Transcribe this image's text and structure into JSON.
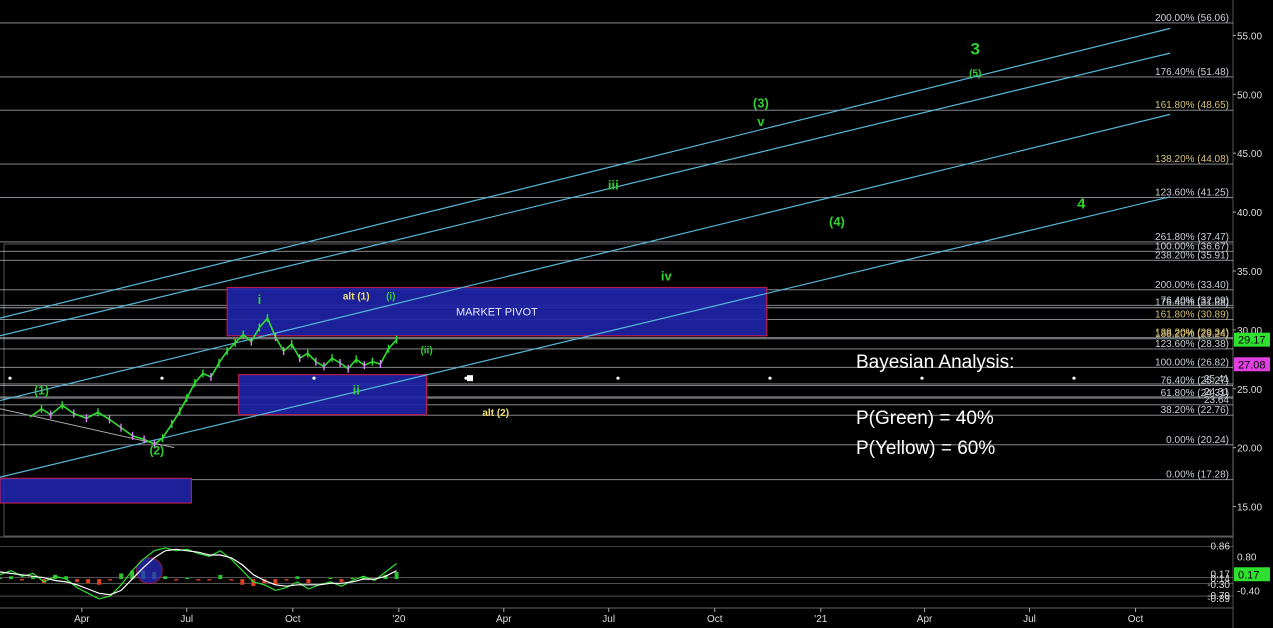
{
  "colors": {
    "background": "#000000",
    "grid": "#3a3a3a",
    "fib_line": "#c8d0d8",
    "fib_text": "#c8d0d8",
    "fib_text_gold": "#d8c27a",
    "channel": "#58b8d8",
    "pivot_box": "#1f24a8",
    "pivot_border": "#c0205a",
    "price_up": "#30e030",
    "price_down": "#e080ff",
    "green_label": "#30d030",
    "yellow_label": "#f0e070",
    "osc_line1": "#30e030",
    "osc_line2": "#ffffff",
    "osc_hist_pos": "#30c030",
    "osc_hist_neg": "#e04020",
    "bayes_text": "#ffffff",
    "price_tag_green": "#30e030",
    "price_tag_magenta": "#e040e0"
  },
  "annotation": {
    "title": "Bayesian Analysis:",
    "p_green": "P(Green) = 40%",
    "p_yellow": "P(Yellow) = 60%"
  },
  "box_labels": {
    "market_pivot": "MARKET PIVOT"
  },
  "chart_data": [
    {
      "type": "line",
      "panel": "price",
      "x_axis_labels": [
        "Apr",
        "Jul",
        "Oct",
        "'20",
        "Apr",
        "Jul",
        "Oct",
        "'21",
        "Apr",
        "Jul",
        "Oct"
      ],
      "y_ticks": [
        15.0,
        20.0,
        25.0,
        30.0,
        35.0,
        40.0,
        45.0,
        50.0,
        55.0
      ],
      "y_tick_labels": [
        "15.00",
        "20.00",
        "25.00",
        "30.00",
        "35.00",
        "40.00",
        "45.00",
        "50.00",
        "55.00"
      ],
      "ylim": [
        12.5,
        57.5
      ],
      "price_tags": [
        {
          "value": 29.17,
          "label": "29.17",
          "color": "green"
        },
        {
          "value": 27.08,
          "label": "27.08",
          "color": "magenta"
        }
      ],
      "fib_levels": [
        {
          "label": "200.00% (56.06)",
          "value": 56.06
        },
        {
          "label": "176.40% (51.48)",
          "value": 51.48
        },
        {
          "label": "161.80% (48.65)",
          "value": 48.65
        },
        {
          "label": "138.20% (44.08)",
          "value": 44.08
        },
        {
          "label": "123.60% (41.25)",
          "value": 41.25
        },
        {
          "label": "261.80% (37.47)",
          "value": 37.47
        },
        {
          "label": "100.00% (36.67)",
          "value": 36.67
        },
        {
          "label": "238.20% (35.91)",
          "value": 35.91
        },
        {
          "label": "200.00% (33.40)",
          "value": 33.4
        },
        {
          "label": "76.40% (32.09)",
          "value": 32.09
        },
        {
          "label": "176.40% (31.88)",
          "value": 31.88
        },
        {
          "label": "161.80% (30.89)",
          "value": 30.89
        },
        {
          "label": "138.20% (29.34)",
          "value": 29.34
        },
        {
          "label": "188.20% (29.24)",
          "value": 29.24
        },
        {
          "label": "123.60% (28.38)",
          "value": 28.38
        },
        {
          "label": "100.00% (26.82)",
          "value": 26.82
        },
        {
          "label": "25.41",
          "value": 25.41
        },
        {
          "label": "76.40% (25.27)",
          "value": 25.27
        },
        {
          "label": "24.31",
          "value": 24.31
        },
        {
          "label": "61.80% (24.31)",
          "value": 24.21
        },
        {
          "label": "23.64",
          "value": 23.64
        },
        {
          "label": "38.20% (22.76)",
          "value": 22.76
        },
        {
          "label": "0.00% (20.24)",
          "value": 20.24
        },
        {
          "label": "0.00% (17.28)",
          "value": 17.28
        }
      ],
      "price_series": [
        [
          "2019-02-15",
          22.6
        ],
        [
          "2019-02-25",
          23.3
        ],
        [
          "2019-03-05",
          22.8
        ],
        [
          "2019-03-15",
          23.6
        ],
        [
          "2019-03-25",
          22.9
        ],
        [
          "2019-04-05",
          22.5
        ],
        [
          "2019-04-15",
          23.0
        ],
        [
          "2019-04-25",
          22.4
        ],
        [
          "2019-05-05",
          21.7
        ],
        [
          "2019-05-15",
          21.0
        ],
        [
          "2019-05-25",
          20.7
        ],
        [
          "2019-06-03",
          20.3
        ],
        [
          "2019-06-10",
          20.8
        ],
        [
          "2019-06-18",
          22.0
        ],
        [
          "2019-06-25",
          23.1
        ],
        [
          "2019-07-01",
          24.2
        ],
        [
          "2019-07-08",
          25.5
        ],
        [
          "2019-07-15",
          26.3
        ],
        [
          "2019-07-22",
          26.0
        ],
        [
          "2019-07-29",
          27.2
        ],
        [
          "2019-08-05",
          28.2
        ],
        [
          "2019-08-12",
          28.9
        ],
        [
          "2019-08-19",
          29.6
        ],
        [
          "2019-08-26",
          29.0
        ],
        [
          "2019-09-02",
          30.2
        ],
        [
          "2019-09-09",
          31.0
        ],
        [
          "2019-09-16",
          29.4
        ],
        [
          "2019-09-23",
          28.2
        ],
        [
          "2019-09-30",
          28.8
        ],
        [
          "2019-10-07",
          27.6
        ],
        [
          "2019-10-14",
          28.0
        ],
        [
          "2019-10-21",
          27.3
        ],
        [
          "2019-10-28",
          26.9
        ],
        [
          "2019-11-04",
          27.6
        ],
        [
          "2019-11-11",
          27.2
        ],
        [
          "2019-11-18",
          26.7
        ],
        [
          "2019-11-25",
          27.5
        ],
        [
          "2019-12-02",
          27.0
        ],
        [
          "2019-12-09",
          27.3
        ],
        [
          "2019-12-16",
          27.1
        ],
        [
          "2019-12-23",
          28.4
        ],
        [
          "2019-12-30",
          29.17
        ]
      ],
      "channel_lines": [
        [
          [
            "2019-01-20",
            31.0
          ],
          [
            "2021-10-31",
            55.6
          ]
        ],
        [
          [
            "2019-01-20",
            29.5
          ],
          [
            "2021-10-31",
            53.5
          ]
        ],
        [
          [
            "2019-01-20",
            24.0
          ],
          [
            "2021-10-31",
            48.3
          ]
        ],
        [
          [
            "2019-01-20",
            17.5
          ],
          [
            "2021-10-31",
            41.3
          ]
        ]
      ],
      "boxes": [
        {
          "from": "2019-08-05",
          "to": "2020-11-15",
          "low": 29.5,
          "high": 33.6,
          "label": "MARKET PIVOT"
        },
        {
          "from": "2019-08-15",
          "to": "2020-01-25",
          "low": 22.8,
          "high": 26.2,
          "label": ""
        },
        {
          "from": "2019-01-20",
          "to": "2019-07-05",
          "low": 15.3,
          "high": 17.4,
          "label": ""
        }
      ],
      "wave_labels": [
        {
          "text": "(1)",
          "x": "2019-02-25",
          "y": 24.5,
          "color": "green",
          "size": "s"
        },
        {
          "text": "(2)",
          "x": "2019-06-05",
          "y": 19.4,
          "color": "green",
          "size": "s"
        },
        {
          "text": "i",
          "x": "2019-09-02",
          "y": 32.2,
          "color": "green",
          "size": "m"
        },
        {
          "text": "ii",
          "x": "2019-11-25",
          "y": 24.5,
          "color": "green",
          "size": "m"
        },
        {
          "text": "alt (1)",
          "x": "2019-11-25",
          "y": 32.6,
          "color": "yellow",
          "size": "xs"
        },
        {
          "text": "(i)",
          "x": "2019-12-25",
          "y": 32.6,
          "color": "green",
          "size": "xs"
        },
        {
          "text": "(ii)",
          "x": "2020-01-25",
          "y": 28.0,
          "color": "green",
          "size": "xs"
        },
        {
          "text": "alt (2)",
          "x": "2020-03-25",
          "y": 22.7,
          "color": "yellow",
          "size": "xs"
        },
        {
          "text": "iii",
          "x": "2020-07-05",
          "y": 41.9,
          "color": "green",
          "size": "m"
        },
        {
          "text": "iv",
          "x": "2020-08-20",
          "y": 34.2,
          "color": "green",
          "size": "m"
        },
        {
          "text": "(3)",
          "x": "2020-11-10",
          "y": 48.9,
          "color": "green",
          "size": "m"
        },
        {
          "text": "v",
          "x": "2020-11-10",
          "y": 47.3,
          "color": "green",
          "size": "m"
        },
        {
          "text": "(4)",
          "x": "2021-01-15",
          "y": 38.8,
          "color": "green",
          "size": "m"
        },
        {
          "text": "3",
          "x": "2021-05-15",
          "y": 53.4,
          "color": "green",
          "size": "xl"
        },
        {
          "text": "(5)",
          "x": "2021-05-15",
          "y": 51.5,
          "color": "green",
          "size": "xs"
        },
        {
          "text": "4",
          "x": "2021-08-15",
          "y": 40.3,
          "color": "green",
          "size": "l"
        }
      ]
    },
    {
      "type": "line",
      "panel": "oscillator",
      "ylim": [
        -0.95,
        1.45
      ],
      "y_tick_labels": [
        "0.80",
        "-0.40"
      ],
      "y_ticks": [
        0.8,
        -0.4
      ],
      "right_labels": [
        {
          "text": "0.86",
          "value": 1.15
        },
        {
          "text": "0.14",
          "value": 0.0
        },
        {
          "text": "0.17",
          "value": 0.17
        },
        {
          "text": "-0.30",
          "value": -0.2
        },
        {
          "text": "-0.79",
          "value": -0.6
        },
        {
          "text": "-0.89",
          "value": -0.7
        }
      ],
      "ref_levels": [
        1.15,
        0.05,
        -0.15,
        -0.6
      ],
      "series": [
        {
          "values": [
            0.15,
            0.3,
            0.1,
            0.2,
            -0.1,
            0.1,
            0.0,
            -0.3,
            -0.5,
            -0.7,
            -0.6,
            -0.2,
            0.3,
            0.7,
            1.0,
            1.1,
            1.0,
            1.05,
            0.9,
            0.8,
            1.0,
            0.7,
            0.3,
            -0.1,
            -0.2,
            -0.4,
            -0.3,
            -0.1,
            -0.35,
            -0.2,
            -0.1,
            -0.25,
            -0.05,
            0.1,
            -0.05,
            0.25,
            0.55
          ]
        },
        {
          "values": [
            0.25,
            0.2,
            0.15,
            0.1,
            0.05,
            -0.05,
            -0.1,
            -0.2,
            -0.35,
            -0.5,
            -0.55,
            -0.4,
            0.0,
            0.4,
            0.75,
            1.0,
            1.05,
            1.0,
            0.95,
            0.85,
            0.85,
            0.75,
            0.5,
            0.15,
            -0.05,
            -0.2,
            -0.25,
            -0.2,
            -0.2,
            -0.2,
            -0.15,
            -0.15,
            -0.1,
            0.0,
            0.0,
            0.1,
            0.3
          ]
        }
      ],
      "histogram": [
        0.05,
        0.1,
        -0.05,
        0.1,
        -0.15,
        0.15,
        0.1,
        -0.1,
        -0.15,
        -0.2,
        -0.05,
        0.2,
        0.3,
        0.3,
        0.25,
        0.1,
        -0.05,
        0.05,
        -0.05,
        -0.05,
        0.15,
        -0.05,
        -0.2,
        -0.25,
        -0.15,
        -0.2,
        -0.05,
        0.1,
        -0.15,
        0.0,
        0.05,
        -0.1,
        0.05,
        0.1,
        -0.05,
        0.15,
        0.25
      ]
    }
  ]
}
